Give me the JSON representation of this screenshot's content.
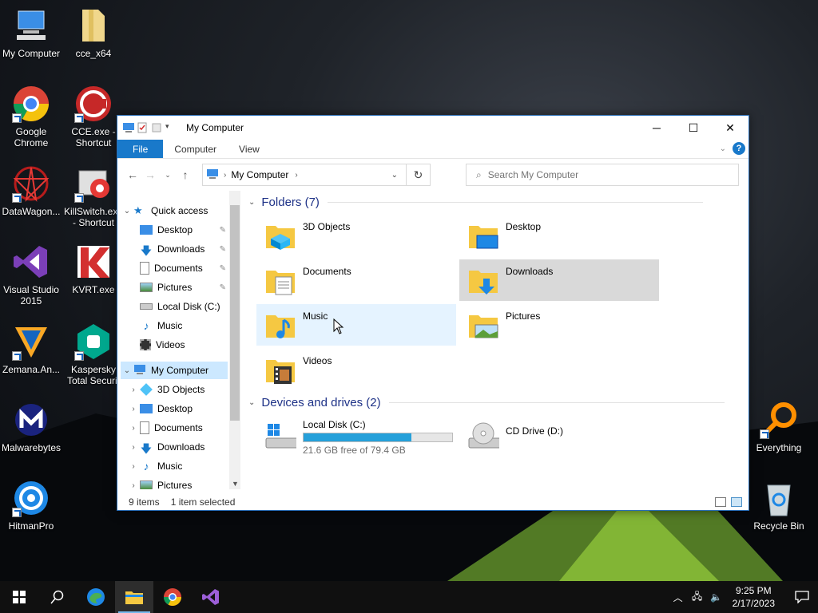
{
  "desktop": {
    "icons": [
      {
        "name": "my-computer-desktop-icon",
        "label": "My Computer"
      },
      {
        "name": "cce-x64-desktop-icon",
        "label": "cce_x64"
      },
      {
        "name": "google-chrome-desktop-icon",
        "label": "Google Chrome"
      },
      {
        "name": "cce-shortcut-desktop-icon",
        "label": "CCE.exe - Shortcut"
      },
      {
        "name": "datawagon-desktop-icon",
        "label": "DataWagon..."
      },
      {
        "name": "killswitch-desktop-icon",
        "label": "KillSwitch.exe - Shortcut"
      },
      {
        "name": "visual-studio-desktop-icon",
        "label": "Visual Studio 2015"
      },
      {
        "name": "kvrt-desktop-icon",
        "label": "KVRT.exe"
      },
      {
        "name": "zemana-desktop-icon",
        "label": "Zemana.An..."
      },
      {
        "name": "kaspersky-desktop-icon",
        "label": "Kaspersky Total Securit"
      },
      {
        "name": "malwarebytes-desktop-icon",
        "label": "Malwarebytes"
      },
      {
        "name": "hitmanpro-desktop-icon",
        "label": "HitmanPro"
      },
      {
        "name": "everything-desktop-icon",
        "label": "Everything"
      },
      {
        "name": "recycle-bin-desktop-icon",
        "label": "Recycle Bin"
      }
    ]
  },
  "window": {
    "title": "My Computer",
    "ribbon": {
      "file": "File",
      "computer": "Computer",
      "view": "View",
      "help": "?"
    },
    "address": {
      "location": "My Computer"
    },
    "search": {
      "placeholder": "Search My Computer"
    },
    "nav": {
      "quick_access": "Quick access",
      "quick_items": [
        {
          "label": "Desktop",
          "pinned": true
        },
        {
          "label": "Downloads",
          "pinned": true
        },
        {
          "label": "Documents",
          "pinned": true
        },
        {
          "label": "Pictures",
          "pinned": true
        },
        {
          "label": "Local Disk (C:)",
          "pinned": false
        },
        {
          "label": "Music",
          "pinned": false
        },
        {
          "label": "Videos",
          "pinned": false
        }
      ],
      "my_computer": "My Computer",
      "computer_items": [
        "3D Objects",
        "Desktop",
        "Documents",
        "Downloads",
        "Music",
        "Pictures"
      ]
    },
    "folders_header": "Folders (7)",
    "folders": [
      "3D Objects",
      "Desktop",
      "Documents",
      "Downloads",
      "Music",
      "Pictures",
      "Videos"
    ],
    "drives_header": "Devices and drives (2)",
    "drives": [
      {
        "label": "Local Disk (C:)",
        "free": "21.6 GB free of 79.4 GB",
        "used_fraction": 0.728
      },
      {
        "label": "CD Drive (D:)"
      }
    ],
    "status": {
      "items": "9 items",
      "selected": "1 item selected"
    }
  },
  "taskbar": {
    "clock_time": "9:25 PM",
    "clock_date": "2/17/2023"
  },
  "colors": {
    "accent": "#1979ca",
    "selection": "#cce8ff",
    "folder": "#f5c842"
  }
}
